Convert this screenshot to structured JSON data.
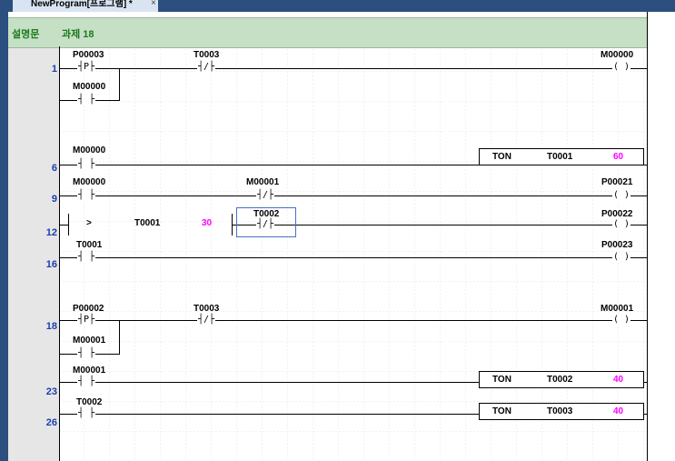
{
  "tab": {
    "title": "NewProgram[프로그램] *",
    "close": "×"
  },
  "description": {
    "label": "설명문",
    "text": "과제 18"
  },
  "rungs": [
    {
      "number": "1"
    },
    {
      "number": "6"
    },
    {
      "number": "9"
    },
    {
      "number": "12"
    },
    {
      "number": "16"
    },
    {
      "number": "18"
    },
    {
      "number": "23"
    },
    {
      "number": "26"
    }
  ],
  "contacts": [
    {
      "label": "P00003",
      "symbol": "┤P├"
    },
    {
      "label": "M00000",
      "symbol": "┤ ├"
    },
    {
      "label": "T0003",
      "symbol": "┤/├"
    },
    {
      "label": "M00000",
      "symbol": "┤ ├"
    },
    {
      "label": "M00000",
      "symbol": "┤ ├"
    },
    {
      "label": "M00001",
      "symbol": "┤/├"
    },
    {
      "label": "T0002",
      "symbol": "┤/├"
    },
    {
      "label": "T0001",
      "symbol": "┤ ├"
    },
    {
      "label": "P00002",
      "symbol": "┤P├"
    },
    {
      "label": "M00001",
      "symbol": "┤ ├"
    },
    {
      "label": "T0003",
      "symbol": "┤/├"
    },
    {
      "label": "M00001",
      "symbol": "┤ ├"
    },
    {
      "label": "T0002",
      "symbol": "┤ ├"
    }
  ],
  "coils": [
    {
      "label": "M00000",
      "symbol": "( )"
    },
    {
      "label": "P00021",
      "symbol": "( )"
    },
    {
      "label": "P00022",
      "symbol": "( )"
    },
    {
      "label": "P00023",
      "symbol": "( )"
    },
    {
      "label": "M00001",
      "symbol": "( )"
    }
  ],
  "compare": {
    "op": ">",
    "a": "T0001",
    "b": "30"
  },
  "timers": [
    {
      "type": "TON",
      "name": "T0001",
      "preset": "60"
    },
    {
      "type": "TON",
      "name": "T0002",
      "preset": "40"
    },
    {
      "type": "TON",
      "name": "T0003",
      "preset": "40"
    }
  ],
  "colors": {
    "rung_number": "#1a3fb0",
    "constant": "#ff00ff",
    "description": "#1d7a1d",
    "desc_bg": "#c5e0c4"
  }
}
